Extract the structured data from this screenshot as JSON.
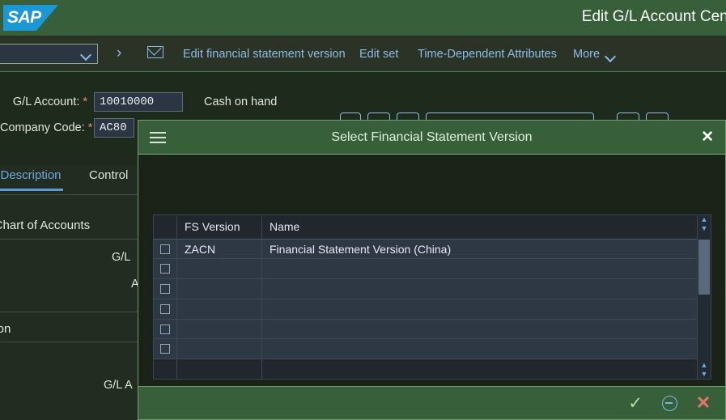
{
  "shell": {
    "logo_text": "SAP",
    "logo_name": "sap-logo",
    "title": "Edit G/L Account Cent"
  },
  "toolbar": {
    "dropdown_value": "",
    "arrow_icon": "›",
    "mail_icon": "mail-icon",
    "links": [
      "Edit financial statement version",
      "Edit set",
      "Time-Dependent Attributes"
    ],
    "more_label": "More"
  },
  "form": {
    "fields": [
      {
        "label": "G/L Account:",
        "required": "*",
        "value": "10010000",
        "description": "Cash on hand"
      },
      {
        "label": "Company Code:",
        "required": "*",
        "value": "AC80",
        "description": ""
      }
    ]
  },
  "tabs": [
    {
      "label": "Description",
      "active": true
    },
    {
      "label": "Control",
      "active": false
    }
  ],
  "background_panel": {
    "section_title": "rol in Chart of Accounts",
    "labels": [
      "G/L",
      "A",
      "cription",
      "G/L A"
    ]
  },
  "dialog": {
    "title": "Select Financial Statement Version",
    "menu_icon": "hamburger-icon",
    "close_label": "✕",
    "table": {
      "columns": [
        "FS Version",
        "Name"
      ],
      "rows": [
        {
          "checked": false,
          "fs_version": "ZACN",
          "name": "Financial Statement Version (China)"
        },
        {
          "checked": false,
          "fs_version": "",
          "name": ""
        },
        {
          "checked": false,
          "fs_version": "",
          "name": ""
        },
        {
          "checked": false,
          "fs_version": "",
          "name": ""
        },
        {
          "checked": false,
          "fs_version": "",
          "name": ""
        },
        {
          "checked": false,
          "fs_version": "",
          "name": ""
        }
      ]
    },
    "scroll": {
      "up_arrow": "▲",
      "down_arrow": "▼"
    },
    "footer": {
      "confirm_icon": "✓",
      "confirm_name": "confirm-button",
      "clear_name": "clear-button",
      "cancel_icon": "✕",
      "cancel_name": "cancel-button"
    }
  },
  "colors": {
    "brand_green": "#37603a",
    "sap_blue": "#1b98d4",
    "link_blue": "#8cbce4",
    "content_bg": "#232c20",
    "table_row": "#2e3845",
    "confirm_green": "#a8e6a0",
    "cancel_red": "#e8736a"
  }
}
